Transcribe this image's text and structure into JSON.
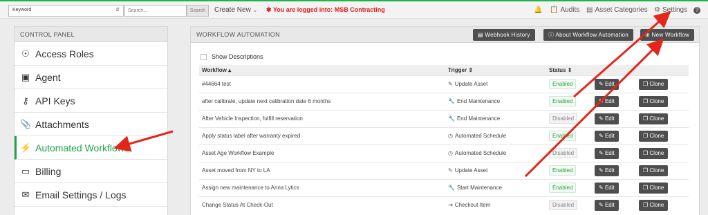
{
  "topbar": {
    "keyword_select": "Keyword",
    "search_placeholder": "Search...",
    "search_button": "Search",
    "create_new": "Create New",
    "logged_in": "You are logged into: MSB Contracting",
    "audits": "Audits",
    "asset_categories": "Asset Categories",
    "settings": "Settings"
  },
  "sidebar": {
    "title": "CONTROL PANEL",
    "items": [
      {
        "label": "Access Roles",
        "icon": "person-circle-icon"
      },
      {
        "label": "Agent",
        "icon": "monitor-icon"
      },
      {
        "label": "API Keys",
        "icon": "key-icon"
      },
      {
        "label": "Attachments",
        "icon": "paperclip-icon"
      },
      {
        "label": "Automated Workflows",
        "icon": "bolt-icon"
      },
      {
        "label": "Billing",
        "icon": "credit-card-icon"
      },
      {
        "label": "Email Settings / Logs",
        "icon": "envelope-icon"
      }
    ]
  },
  "main": {
    "title": "WORKFLOW AUTOMATION",
    "webhook_history": "Webhook History",
    "about": "About Workflow Automation",
    "new_workflow": "New Workflow",
    "show_descriptions": "Show Descriptions",
    "columns": [
      "Workflow",
      "Trigger",
      "Status"
    ],
    "edit_label": "Edit",
    "clone_label": "Clone",
    "rows": [
      {
        "name": "#44664 test",
        "trigger": "Update Asset",
        "trigger_icon": "edit-icon",
        "status": "Enabled"
      },
      {
        "name": "after calibrate, update next calibration date 6 months",
        "trigger": "End Maintenance",
        "trigger_icon": "wrench-icon",
        "status": "Enabled"
      },
      {
        "name": "After Vehicle Inspection, fulfill reservation",
        "trigger": "End Maintenance",
        "trigger_icon": "wrench-icon",
        "status": "Disabled"
      },
      {
        "name": "Apply status label after warranty expired",
        "trigger": "Automated Schedule",
        "trigger_icon": "clock-icon",
        "status": "Enabled"
      },
      {
        "name": "Asset Age Workflow Example",
        "trigger": "Automated Schedule",
        "trigger_icon": "clock-icon",
        "status": "Disabled"
      },
      {
        "name": "Asset moved from NY to LA",
        "trigger": "Update Asset",
        "trigger_icon": "edit-icon",
        "status": "Enabled"
      },
      {
        "name": "Assign new maintenance to Anna Lytics",
        "trigger": "Start Maintenance",
        "trigger_icon": "wrench-icon",
        "status": "Enabled"
      },
      {
        "name": "Change Status At Check-Out",
        "trigger": "Checkout Item",
        "trigger_icon": "sign-out-icon",
        "status": "Disabled"
      }
    ]
  },
  "colors": {
    "accent_green": "#1fa34a",
    "alert_red": "#e01919",
    "button_dark": "#4e4e4e"
  }
}
